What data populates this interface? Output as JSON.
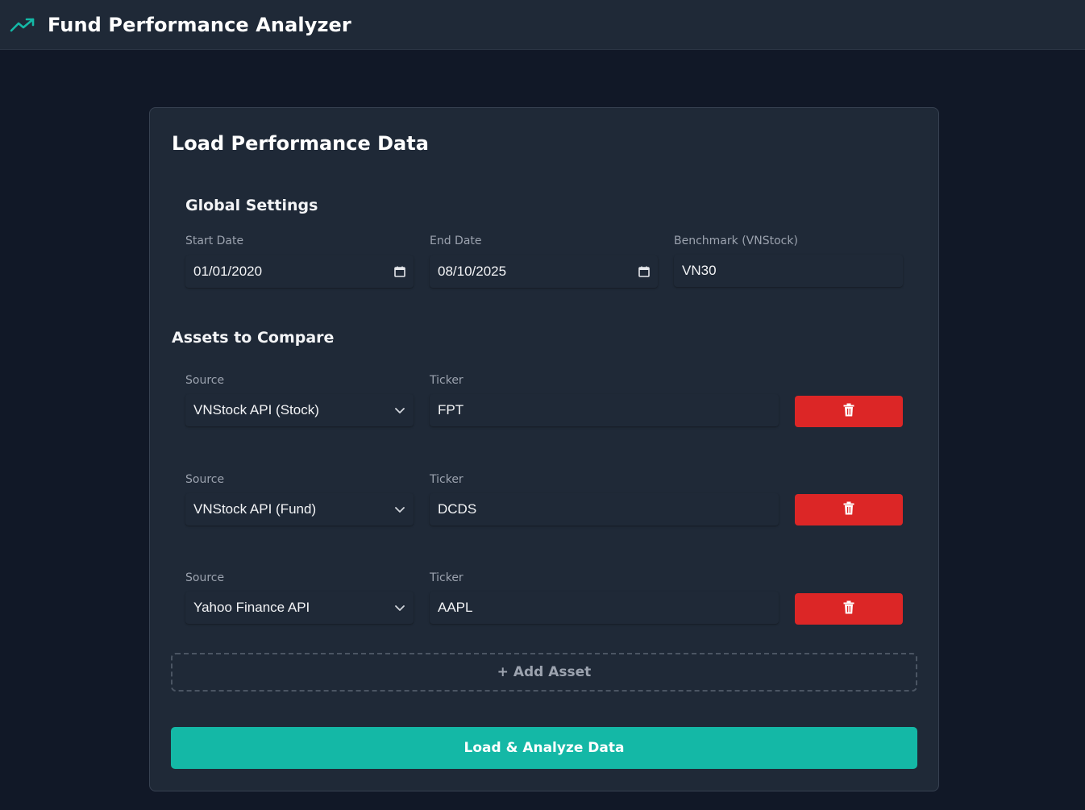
{
  "header": {
    "title": "Fund Performance Analyzer",
    "icon": "trending-up-icon",
    "accent": "#14b8a6"
  },
  "card": {
    "title": "Load Performance Data"
  },
  "global_settings": {
    "title": "Global Settings",
    "start_date": {
      "label": "Start Date",
      "value": "01/01/2020"
    },
    "end_date": {
      "label": "End Date",
      "value": "08/10/2025"
    },
    "benchmark": {
      "label": "Benchmark (VNStock)",
      "value": "VN30"
    }
  },
  "assets": {
    "title": "Assets to Compare",
    "items": [
      {
        "source_label": "Source",
        "source": "VNStock API (Stock)",
        "ticker_label": "Ticker",
        "ticker": "FPT"
      },
      {
        "source_label": "Source",
        "source": "VNStock API (Fund)",
        "ticker_label": "Ticker",
        "ticker": "DCDS"
      },
      {
        "source_label": "Source",
        "source": "Yahoo Finance API",
        "ticker_label": "Ticker",
        "ticker": "AAPL"
      }
    ],
    "delete_color": "#dc2626"
  },
  "actions": {
    "add_asset": "+ Add Asset",
    "load_analyze": "Load & Analyze Data"
  }
}
